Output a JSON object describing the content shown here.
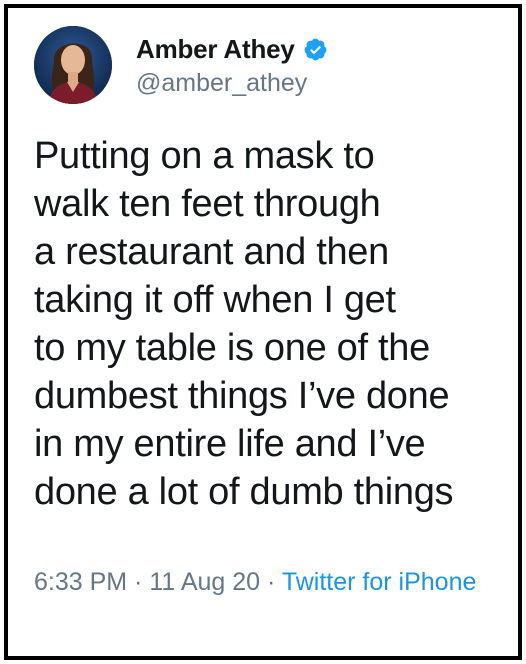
{
  "author": {
    "display_name": "Amber Athey",
    "handle": "@amber_athey",
    "verified": true,
    "verified_icon": "verified-badge-icon",
    "avatar_icon": "profile-photo"
  },
  "tweet": {
    "text": "Putting on a mask to\nwalk ten feet through\na restaurant and then\ntaking it off when I get\nto my table is one of the\ndumbest things I’ve done\nin my entire life and I’ve\ndone a lot of dumb things",
    "time": "6:33 PM",
    "separator": " · ",
    "date": "11 Aug 20",
    "source": "Twitter for iPhone"
  },
  "colors": {
    "text_primary": "#14171a",
    "text_secondary": "#657786",
    "link": "#1b95e0",
    "verified": "#1da1f2",
    "frame_border": "#000000"
  }
}
